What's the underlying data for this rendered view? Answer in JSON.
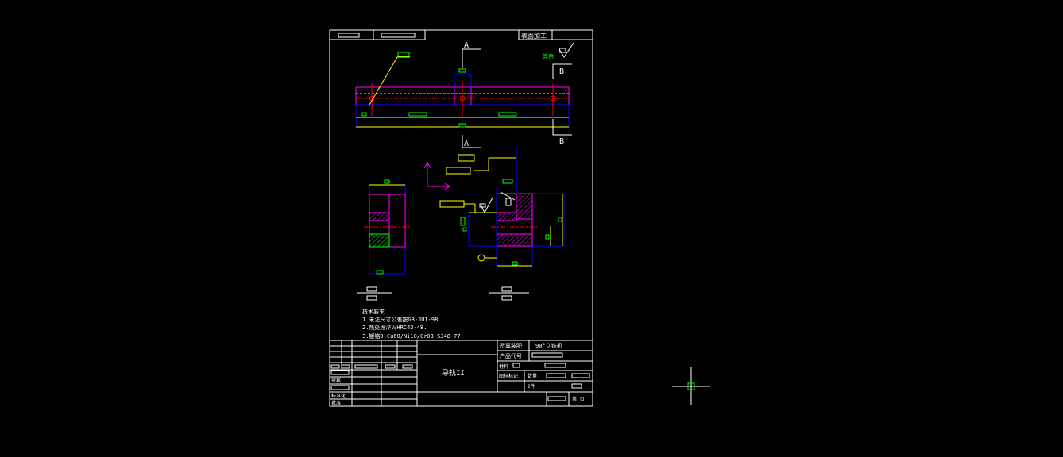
{
  "colors": {
    "background": "#000000",
    "border": "#ffffff",
    "outline": "#0000ff",
    "profile": "#ff00ff",
    "dimension": "#00ff00",
    "leader": "#ffff00",
    "centerline": "#ff0000",
    "crosshair": "#00ff00"
  },
  "header": {
    "surface_treatment": "表面加工"
  },
  "section_labels": {
    "a_top": "A",
    "a_bottom": "A",
    "b_top": "B",
    "b_bottom": "B"
  },
  "roughness": {
    "rest_label": "其余"
  },
  "tech_requirements": {
    "title": "技术要求",
    "lines": [
      "1.未注尺寸公差按GB-JUI-98.",
      "2.热处理淬火HRC43-48.",
      "3.镀铬D.Cu60/Ni10/Cr03  SJ48-77."
    ]
  },
  "title_block": {
    "part_name": "导轨II",
    "assembly_label": "所属装配",
    "assembly_value": "90°立铣机",
    "product_code_label": "产品代号",
    "material_label": "材料",
    "drawing_no_label": "图样标记",
    "quantity_label": "数量",
    "weight_label": "2件",
    "review_label": "审核",
    "standard_label": "标准化",
    "approve_label": "批准",
    "sheet_label": "第  页"
  },
  "cursor": {
    "icon": "crosshair-cursor-icon"
  }
}
